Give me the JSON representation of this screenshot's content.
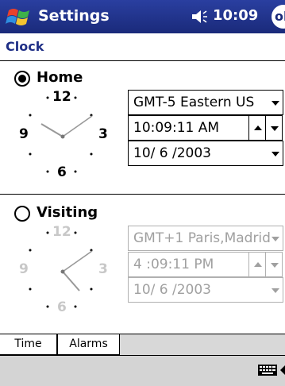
{
  "titlebar": {
    "app_title": "Settings",
    "time": "10:09",
    "ok_label": "ok"
  },
  "page": {
    "title": "Clock"
  },
  "home": {
    "label": "Home",
    "selected": true,
    "timezone": "GMT-5 Eastern US",
    "time": "10:09:11 AM",
    "date": "10/ 6 /2003",
    "dial": {
      "n12": "12",
      "n3": "3",
      "n6": "6",
      "n9": "9"
    }
  },
  "visiting": {
    "label": "Visiting",
    "selected": false,
    "timezone": "GMT+1 Paris,Madrid",
    "time": "4 :09:11 PM",
    "date": "10/ 6 /2003",
    "dial": {
      "n12": "12",
      "n3": "3",
      "n6": "6",
      "n9": "9"
    }
  },
  "tabs": [
    {
      "label": "Time",
      "active": true
    },
    {
      "label": "Alarms",
      "active": false
    }
  ],
  "icons": {
    "start": "windows-flag-icon",
    "volume": "speaker-icon",
    "keyboard": "keyboard-icon"
  },
  "colors": {
    "titlebar": "#1f2f86",
    "accent_title": "#1f2f86",
    "disabled_text": "#a0a0a0"
  }
}
